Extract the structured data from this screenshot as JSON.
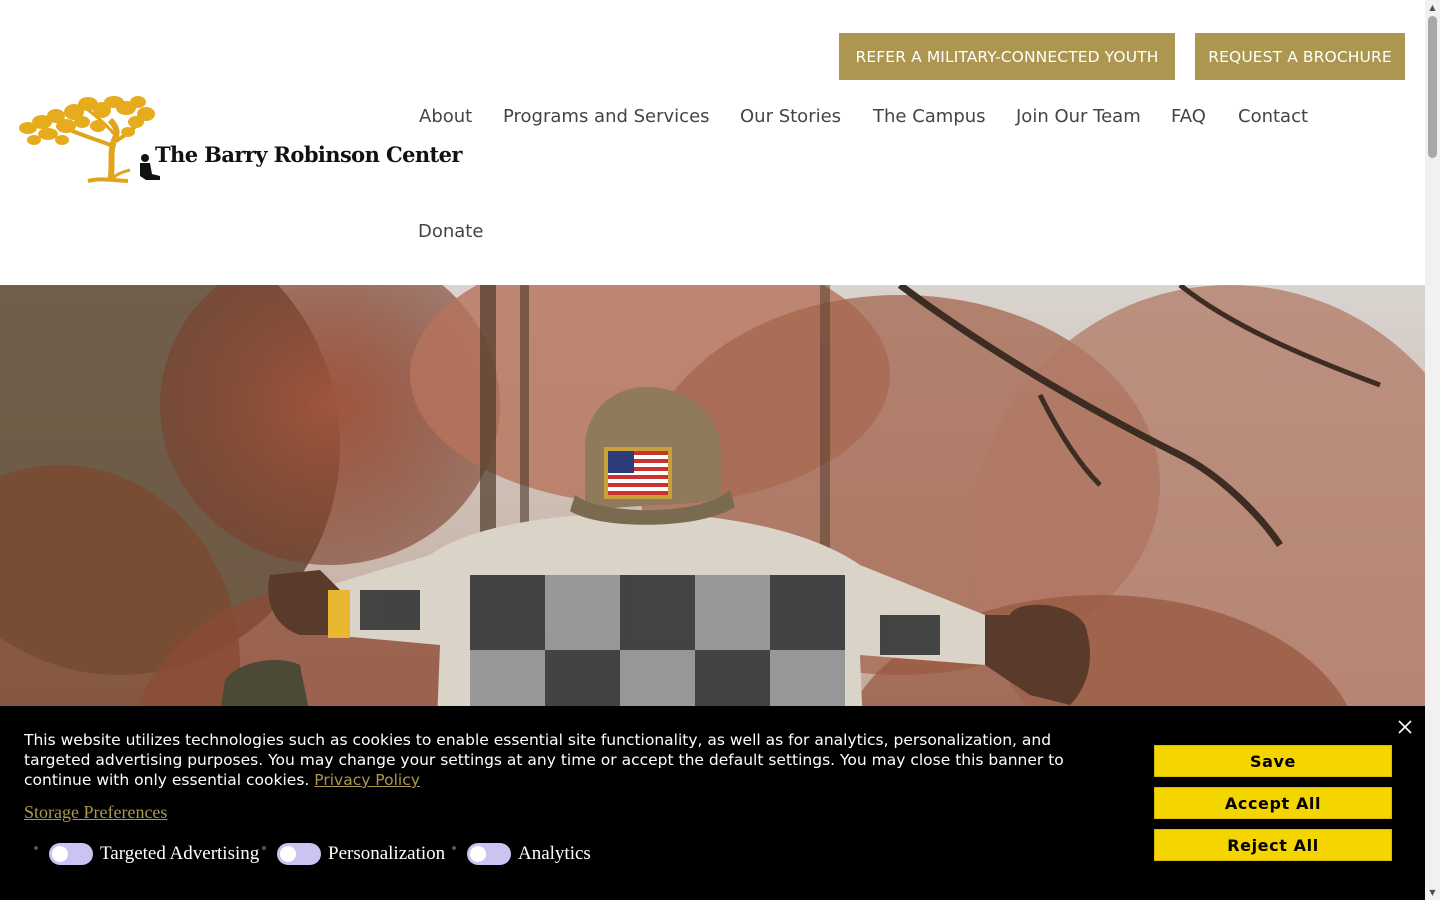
{
  "header": {
    "cta_buttons": [
      {
        "label": "REFER A MILITARY-CONNECTED YOUTH"
      },
      {
        "label": "REQUEST A BROCHURE"
      }
    ],
    "logo_text": "The Barry Robinson Center",
    "nav": [
      {
        "label": "About"
      },
      {
        "label": "Programs and Services"
      },
      {
        "label": "Our Stories"
      },
      {
        "label": "The Campus"
      },
      {
        "label": "Join Our Team"
      },
      {
        "label": "FAQ"
      },
      {
        "label": "Contact"
      },
      {
        "label": "Donate"
      }
    ]
  },
  "hero": {
    "image": "child-in-flag-cap-outdoors"
  },
  "cookie_banner": {
    "text": "This website utilizes technologies such as cookies to enable essential site functionality, as well as for analytics, personalization, and targeted advertising purposes. You may change your settings at any time or accept the default settings. You may close this banner to continue with only essential cookies.",
    "privacy_link": "Privacy Policy",
    "storage_link": "Storage Preferences",
    "toggles": [
      {
        "label": "Targeted Advertising",
        "on": false
      },
      {
        "label": "Personalization",
        "on": false
      },
      {
        "label": "Analytics",
        "on": false
      }
    ],
    "buttons": {
      "save": "Save",
      "accept_all": "Accept All",
      "reject_all": "Reject All"
    },
    "close_icon": "close-icon"
  },
  "colors": {
    "gold": "#ad9650",
    "banner_bg": "#000000",
    "button_yellow": "#f5d500",
    "toggle_off": "#c9c4f2"
  }
}
